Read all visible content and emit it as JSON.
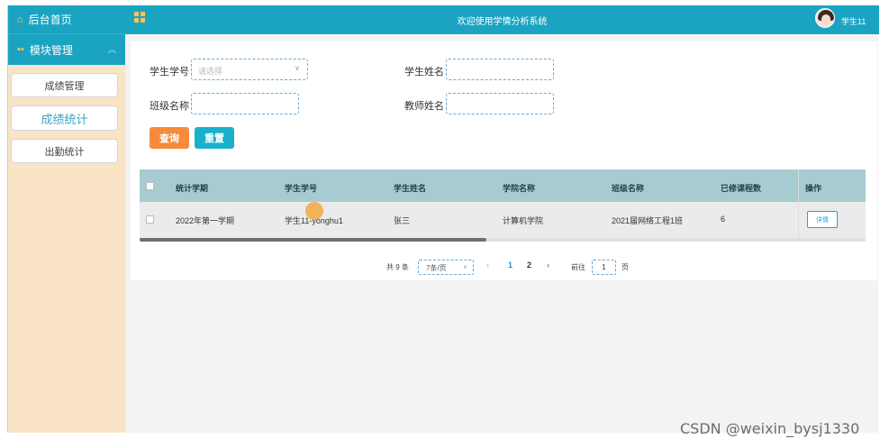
{
  "sidebar": {
    "home_label": "后台首页",
    "module_label": "模块管理",
    "items": [
      {
        "label": "成绩管理"
      },
      {
        "label": "成绩统计"
      },
      {
        "label": "出勤统计"
      }
    ]
  },
  "topbar": {
    "title": "欢迎使用学情分析系统",
    "user": "学生11"
  },
  "search": {
    "student_no_label": "学生学号",
    "student_no_placeholder": "请选择",
    "student_name_label": "学生姓名",
    "class_name_label": "班级名称",
    "teacher_name_label": "教师姓名",
    "query_label": "查询",
    "reset_label": "重置"
  },
  "table": {
    "columns": [
      "统计学期",
      "学生学号",
      "学生姓名",
      "学院名称",
      "班级名称",
      "已修课程数",
      "操作"
    ],
    "rows": [
      {
        "term": "2022年第一学期",
        "student_no": "学生11-yonghu1",
        "student_name": "张三",
        "college": "计算机学院",
        "class_name": "2021届网络工程1班",
        "courses": "6",
        "action": "详情"
      }
    ]
  },
  "pagination": {
    "total_text": "共 9 条",
    "page_size": "7条/页",
    "prev": "‹",
    "page1": "1",
    "page2": "2",
    "next": "›",
    "goto_label": "前往",
    "goto_value": "1",
    "page_unit": "页"
  },
  "watermark": "CSDN @weixin_bysj1330",
  "colors": {
    "primary": "#1aa4c2",
    "sidebar_bg": "#f9e4c6",
    "header_row": "#a6ccd2",
    "query_btn": "#f58b3b",
    "reset_btn": "#1ab0cc"
  }
}
